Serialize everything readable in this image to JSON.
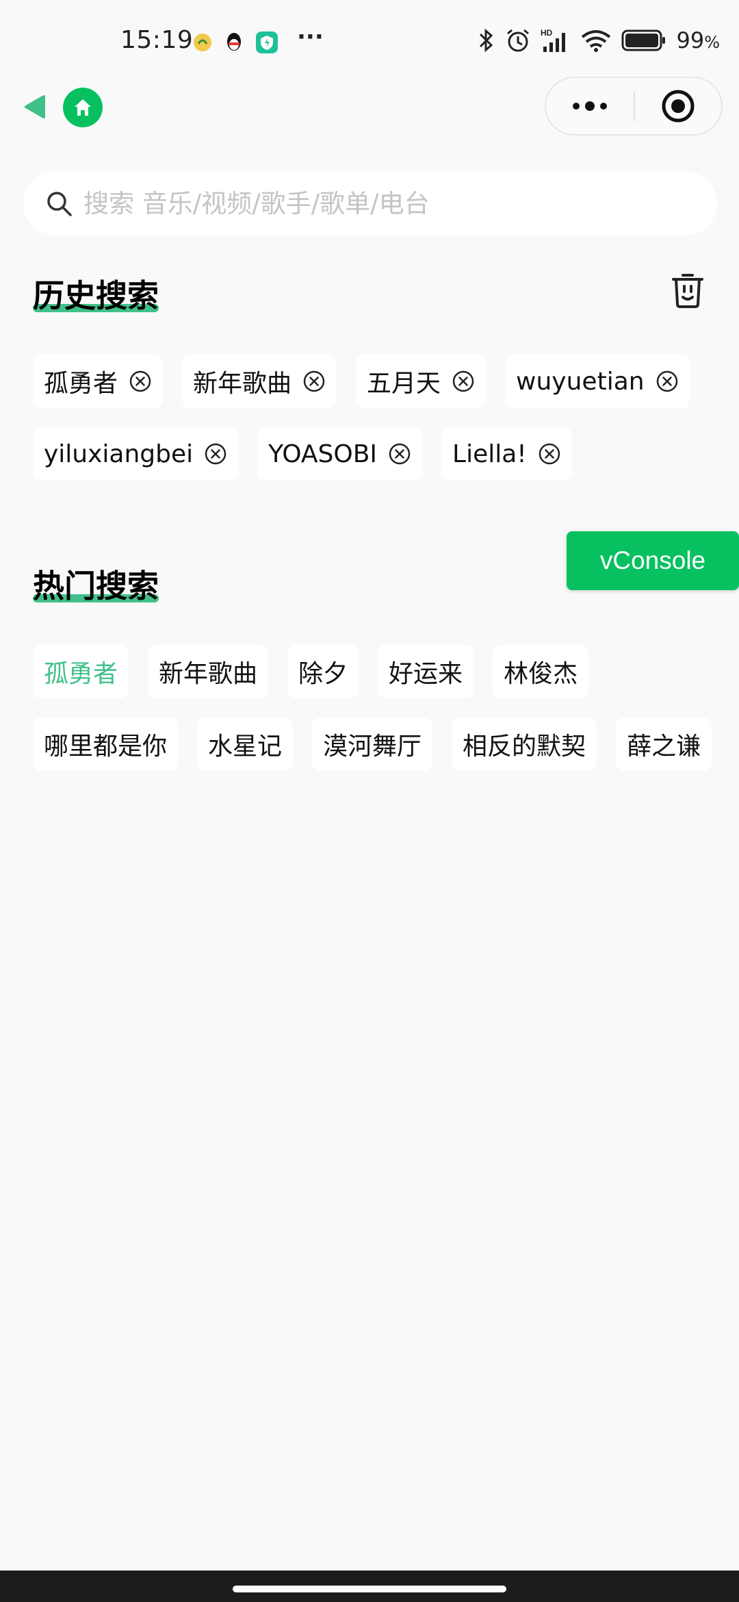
{
  "status_bar": {
    "time": "15:19",
    "battery": "99",
    "battery_unit": "%",
    "more_dots": "···"
  },
  "nav": {
    "back_icon": "triangle-left-icon",
    "home_icon": "home-icon",
    "more_icon": "more-dots-icon",
    "close_icon": "target-icon"
  },
  "search": {
    "placeholder": "搜索 音乐/视频/歌手/歌单/电台",
    "value": ""
  },
  "history": {
    "title": "历史搜索",
    "tags": [
      "孤勇者",
      "新年歌曲",
      "五月天",
      "wuyuetian",
      "yiluxiangbei",
      "YOASOBI",
      "Liella!"
    ]
  },
  "hot": {
    "title": "热门搜索",
    "tags": [
      "孤勇者",
      "新年歌曲",
      "除夕",
      "好运来",
      "林俊杰",
      "哪里都是你",
      "水星记",
      "漠河舞厅",
      "相反的默契",
      "薛之谦"
    ]
  },
  "vconsole": {
    "label": "vConsole"
  },
  "colors": {
    "accent": "#41c08a",
    "wechat_green": "#07c160",
    "background": "#f9f9f9"
  }
}
